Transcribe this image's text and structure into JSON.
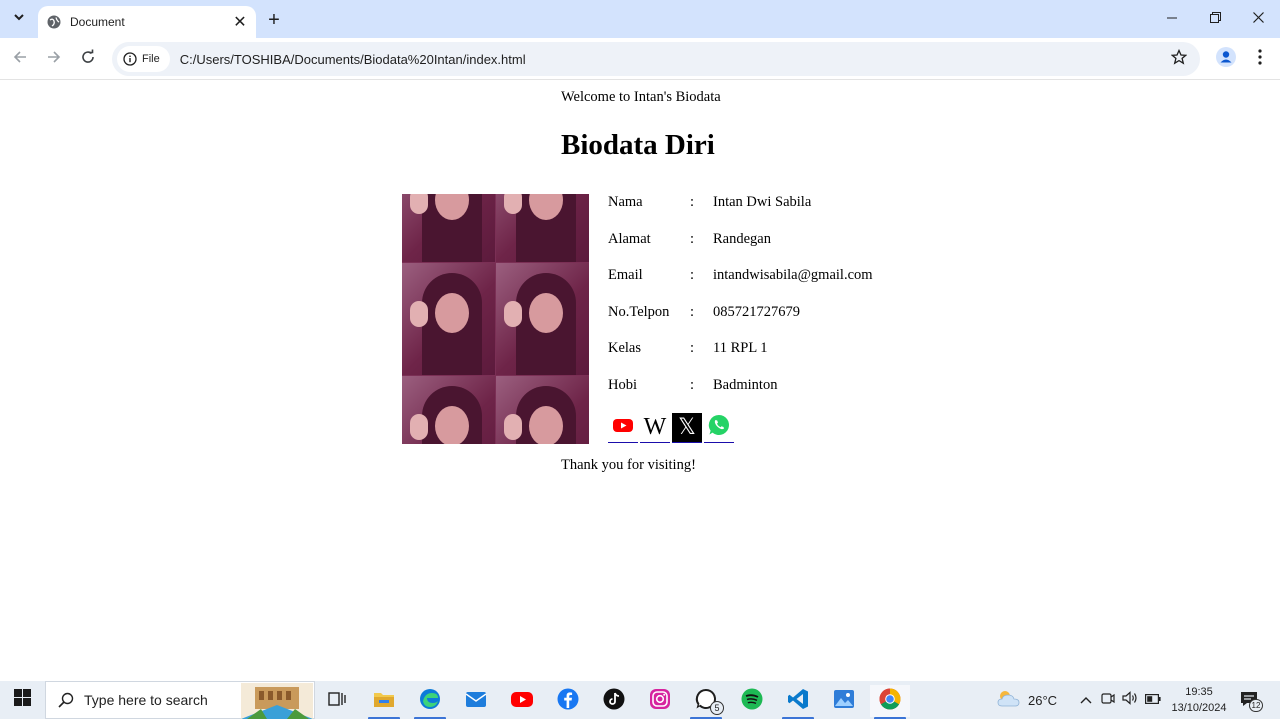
{
  "browser": {
    "tab_title": "Document",
    "new_tab_symbol": "+",
    "close_tab_symbol": "✕",
    "site_chip_label": "File",
    "url": "C:/Users/TOSHIBA/Documents/Biodata%20Intan/index.html"
  },
  "page": {
    "welcome": "Welcome to Intan's Biodata",
    "heading": "Biodata Diri",
    "biodata": [
      {
        "label": "Nama",
        "separator": ":",
        "value": "Intan Dwi Sabila"
      },
      {
        "label": "Alamat",
        "separator": ":",
        "value": "Randegan"
      },
      {
        "label": "Email",
        "separator": ":",
        "value": "intandwisabila@gmail.com"
      },
      {
        "label": "No.Telpon",
        "separator": ":",
        "value": "085721727679"
      },
      {
        "label": "Kelas",
        "separator": ":",
        "value": "11 RPL 1"
      },
      {
        "label": "Hobi",
        "separator": ":",
        "value": "Badminton"
      }
    ],
    "social_icons": [
      "youtube-icon",
      "wikipedia-icon",
      "x-icon",
      "whatsapp-icon"
    ],
    "wiki_glyph": "W",
    "x_glyph": "𝕏",
    "thanks": "Thank you for visiting!"
  },
  "taskbar": {
    "search_placeholder": "Type here to search",
    "whatsapp_badge": "5",
    "temperature": "26°C",
    "time": "19:35",
    "date": "13/10/2024",
    "notification_count": "12"
  },
  "colors": {
    "tabbar": "#d3e3fd",
    "taskbar": "#e8eef5",
    "accent": "#3b74d6"
  }
}
